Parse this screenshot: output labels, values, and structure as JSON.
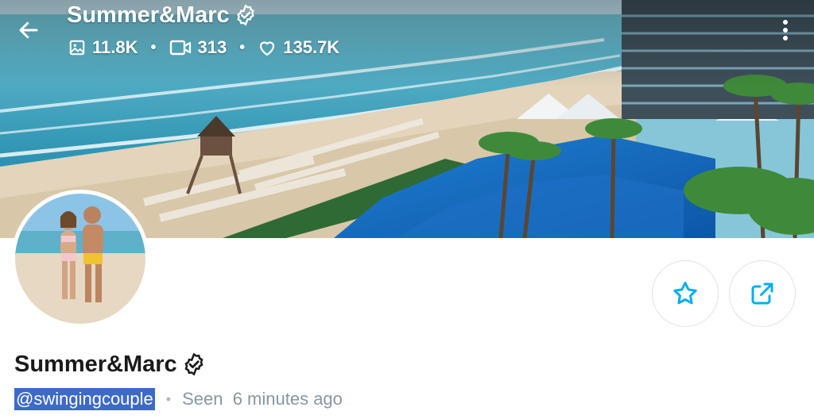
{
  "header": {
    "title": "Summer&Marc",
    "stats": {
      "photos": "11.8K",
      "videos": "313",
      "likes": "135.7K"
    },
    "icons": {
      "back": "arrow-left-icon",
      "verified": "verified-badge-icon",
      "photos": "image-icon",
      "videos": "video-icon",
      "likes": "heart-icon",
      "more": "more-vertical-icon"
    }
  },
  "profile": {
    "name": "Summer&Marc",
    "handle": "@swingingcouple",
    "separator": "•",
    "last_seen": "Seen  6 minutes ago"
  },
  "actions": {
    "favorite_icon": "star-icon",
    "share_icon": "share-icon"
  },
  "colors": {
    "accent": "#00aff0",
    "handle_highlight": "#3d6ac7",
    "muted_text": "#8a96a3"
  }
}
